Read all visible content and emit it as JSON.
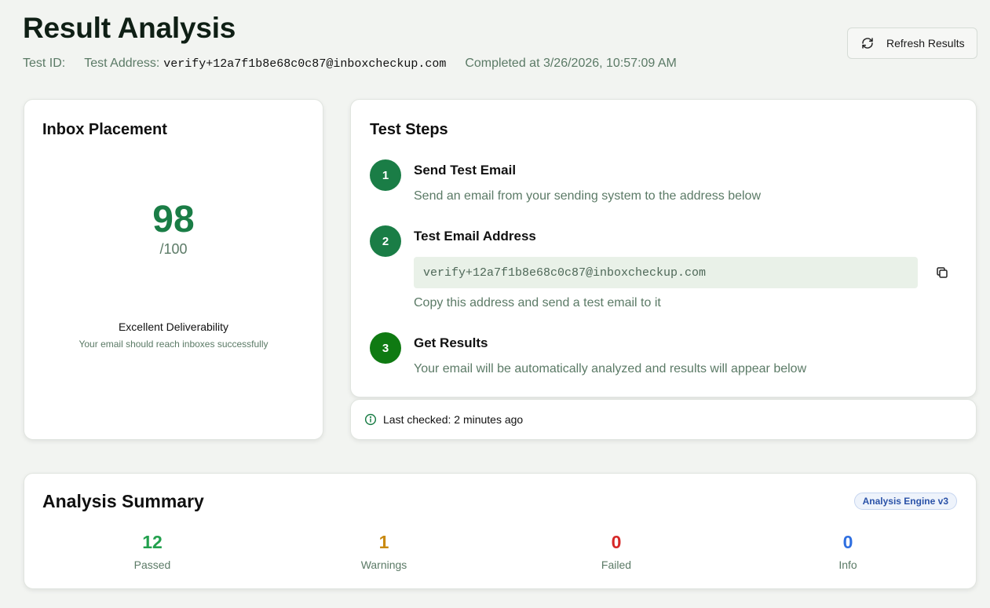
{
  "header": {
    "title": "Result Analysis",
    "test_id_label": "Test ID:",
    "test_address_label": "Test Address:",
    "test_address": "verify+12a7f1b8e68c0c87@inboxcheckup.com",
    "completed": "Completed at 3/26/2026, 10:57:09 AM",
    "refresh_label": "Refresh Results",
    "refresh_icon": "refresh-icon"
  },
  "inbox_placement": {
    "title": "Inbox Placement",
    "score": "98",
    "score_max": "/100",
    "verdict": "Excellent Deliverability",
    "verdict_sub": "Your email should reach inboxes successfully",
    "score_color": "#1a7d46"
  },
  "test_steps": {
    "title": "Test Steps",
    "steps": [
      {
        "number": "1",
        "title": "Send Test Email",
        "description": "Send an email from your sending system to the address below"
      },
      {
        "number": "2",
        "title": "Test Email Address",
        "address": "verify+12a7f1b8e68c0c87@inboxcheckup.com",
        "description": "Copy this address and send a test email to it"
      },
      {
        "number": "3",
        "title": "Get Results",
        "description": "Your email will be automatically analyzed and results will appear below"
      }
    ],
    "copy_icon": "copy-icon"
  },
  "status": {
    "last_checked": "Last checked: 2 minutes ago",
    "icon": "info-icon"
  },
  "summary": {
    "title": "Analysis Summary",
    "badge": "Analysis Engine v3",
    "stats": [
      {
        "value": "12",
        "label": "Passed",
        "color": "#22a04d"
      },
      {
        "value": "1",
        "label": "Warnings",
        "color": "#c98a12"
      },
      {
        "value": "0",
        "label": "Failed",
        "color": "#d62828"
      },
      {
        "value": "0",
        "label": "Info",
        "color": "#2f6fe0"
      }
    ]
  }
}
